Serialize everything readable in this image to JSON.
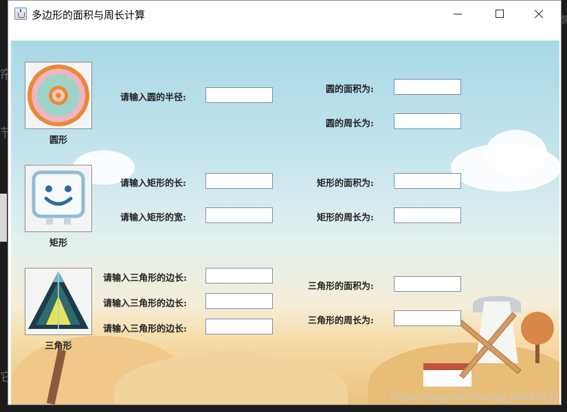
{
  "window": {
    "title": "多边形的面积与周长计算",
    "icon": "java-cup-icon"
  },
  "circle": {
    "caption": "圆形",
    "radius_label": "请输入圆的半径:",
    "radius_value": "",
    "area_label": "圆的面积为:",
    "area_value": "",
    "perimeter_label": "圆的周长为:",
    "perimeter_value": ""
  },
  "rectangle": {
    "caption": "矩形",
    "length_label": "请输入矩形的长:",
    "length_value": "",
    "width_label": "请输入矩形的宽:",
    "width_value": "",
    "area_label": "矩形的面积为:",
    "area_value": "",
    "perimeter_label": "矩形的周长为:",
    "perimeter_value": ""
  },
  "triangle": {
    "caption": "三角形",
    "side1_label": "请输入三角形的边长:",
    "side1_value": "",
    "side2_label": "请输入三角形的边长:",
    "side2_value": "",
    "side3_label": "请输入三角形的边长:",
    "side3_value": "",
    "area_label": "三角形的面积为:",
    "area_value": "",
    "perimeter_label": "三角形的周长为:",
    "perimeter_value": ""
  },
  "watermark": "https://blog.csdn.net/qq_44888152",
  "colors": {
    "sky": "#a9d8e6",
    "field": "#eac27d",
    "input_border": "#7a8ea8"
  }
}
